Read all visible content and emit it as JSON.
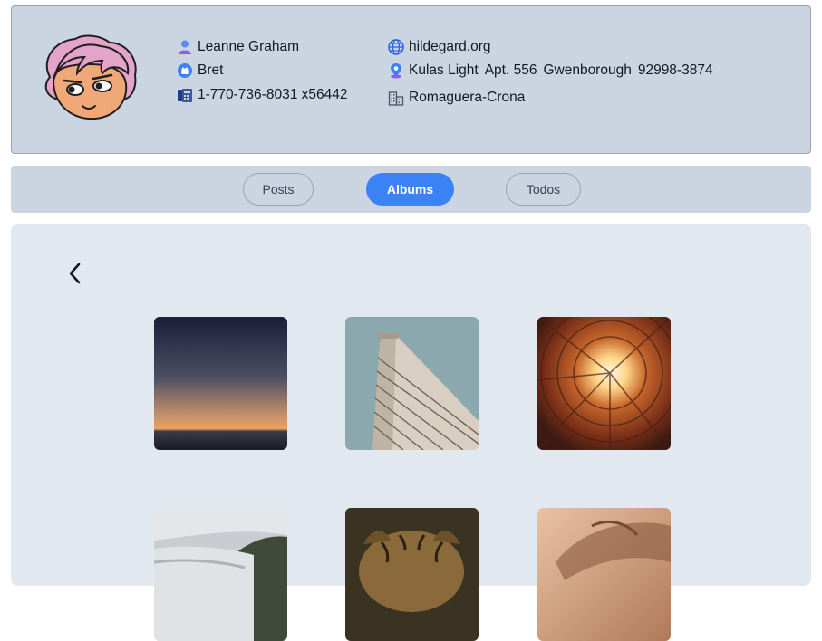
{
  "user": {
    "name": "Leanne Graham",
    "username": "Bret",
    "phone": "1-770-736-8031 x56442",
    "website": "hildegard.org",
    "address": {
      "street": "Kulas Light",
      "suite": "Apt. 556",
      "city": "Gwenborough",
      "zipcode": "92998-3874"
    },
    "company": "Romaguera-Crona"
  },
  "tabs": [
    {
      "label": "Posts",
      "active": false
    },
    {
      "label": "Albums",
      "active": true
    },
    {
      "label": "Todos",
      "active": false
    }
  ],
  "icons": {
    "name": "user-icon",
    "username": "github-icon",
    "phone": "phone-icon",
    "website": "globe-icon",
    "address": "map-pin-icon",
    "company": "building-icon",
    "back": "chevron-left-icon"
  },
  "colors": {
    "header_bg": "#cbd5e1",
    "content_bg": "#e2e8f0",
    "accent": "#3b82f6"
  },
  "photos": [
    {
      "subject": "sunset-horizon"
    },
    {
      "subject": "flatiron-building"
    },
    {
      "subject": "courtyard-sun"
    },
    {
      "subject": "waterfall-cliffs"
    },
    {
      "subject": "tiger"
    },
    {
      "subject": "hand"
    }
  ]
}
